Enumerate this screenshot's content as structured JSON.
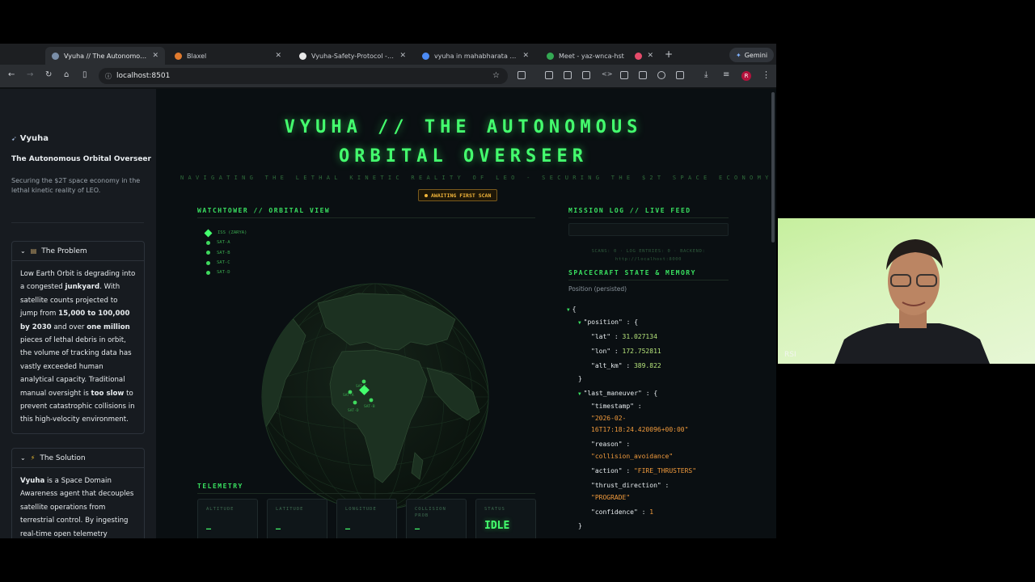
{
  "browser": {
    "tabs": [
      {
        "label": "Vyuha // The Autonomous Orbital Overseer",
        "active": true,
        "favicon_color": "#7a8ea8"
      },
      {
        "label": "Blaxel",
        "active": false,
        "favicon_color": "#e07a2e"
      },
      {
        "label": "Vyuha-Safety-Protocol - Whi",
        "active": false,
        "favicon_color": "#e8e8e8"
      },
      {
        "label": "vyuha in mahabharata meani",
        "active": false,
        "favicon_color": "#4c8bf5"
      },
      {
        "label": "Meet - yaz-wnca-hst",
        "active": false,
        "favicon_color": "#34a853"
      },
      {
        "label": "",
        "active": false,
        "favicon_color": "#e54b6a"
      }
    ],
    "new_tab": "+",
    "gemini_label": "Gemini",
    "url": "localhost:8501",
    "profile_initial": "R"
  },
  "sidebar": {
    "app_name": "Vyuha",
    "subtitle": "The Autonomous Orbital Overseer",
    "description": "Securing the $2T space economy in the lethal kinetic reality of LEO.",
    "problem": {
      "title": "The Problem",
      "t1": "Low Earth Orbit is degrading into a congested ",
      "b1": "junkyard",
      "t2": ". With satellite counts projected to jump from ",
      "b2": "15,000 to 100,000 by 2030",
      "t3": " and over ",
      "b3": "one million",
      "t4": " pieces of lethal debris in orbit, the volume of tracking data has vastly exceeded human analytical capacity. Traditional manual oversight is ",
      "b4": "too slow",
      "t5": " to prevent catastrophic collisions in this high-velocity environment."
    },
    "solution": {
      "title": "The Solution",
      "b1": "Vyuha",
      "t1": " is a Space Domain Awareness agent that decouples satellite operations from terrestrial control. By ingesting real-time open telemetry"
    }
  },
  "main": {
    "title_line1": "VYUHA // THE AUTONOMOUS",
    "title_line2": "ORBITAL OVERSEER",
    "tagline": "NAVIGATING THE LETHAL KINETIC REALITY OF LEO - SECURING THE $2T SPACE ECONOMY",
    "status_badge": "AWAITING FIRST SCAN",
    "watchtower_header": "WATCHTOWER // ORBITAL VIEW",
    "legend": [
      "ISS (ZARYA)",
      "SAT-A",
      "SAT-B",
      "SAT-C",
      "SAT-D"
    ],
    "globe_labels": [
      "SAT-C",
      "SAT-A",
      "SAT-D",
      "SAT-B"
    ],
    "telemetry_header": "TELEMETRY",
    "telemetry": [
      {
        "label": "ALTITUDE",
        "value": "—"
      },
      {
        "label": "LATITUDE",
        "value": "—"
      },
      {
        "label": "LONGITUDE",
        "value": "—"
      },
      {
        "label": "COLLISION PROB",
        "value": "—"
      },
      {
        "label": "STATUS",
        "value": "IDLE"
      }
    ],
    "mission_log_header": "MISSION LOG // LIVE FEED",
    "scan_status": "SCANS: 0 · LOG ENTRIES: 0 · BACKEND: http://localhost:8000",
    "state_header": "SPACECRAFT STATE & MEMORY",
    "position_label": "Position (persisted)",
    "state": {
      "position": {
        "lat": "31.027134",
        "lon": "172.752811",
        "alt_km": "389.822"
      },
      "last_maneuver": {
        "timestamp_1": "\"2026-02-",
        "timestamp_2": "16T17:18:24.420096+00:00\"",
        "reason": "\"collision_avoidance\"",
        "action": "\"FIRE_THRUSTERS\"",
        "thrust_direction": "\"PROGRADE\"",
        "confidence": "1"
      }
    }
  },
  "webcam": {
    "name": "RSI"
  },
  "colors": {
    "accent": "#44ff6e",
    "warning": "#f2b53a",
    "json_string": "#f09a3c"
  }
}
